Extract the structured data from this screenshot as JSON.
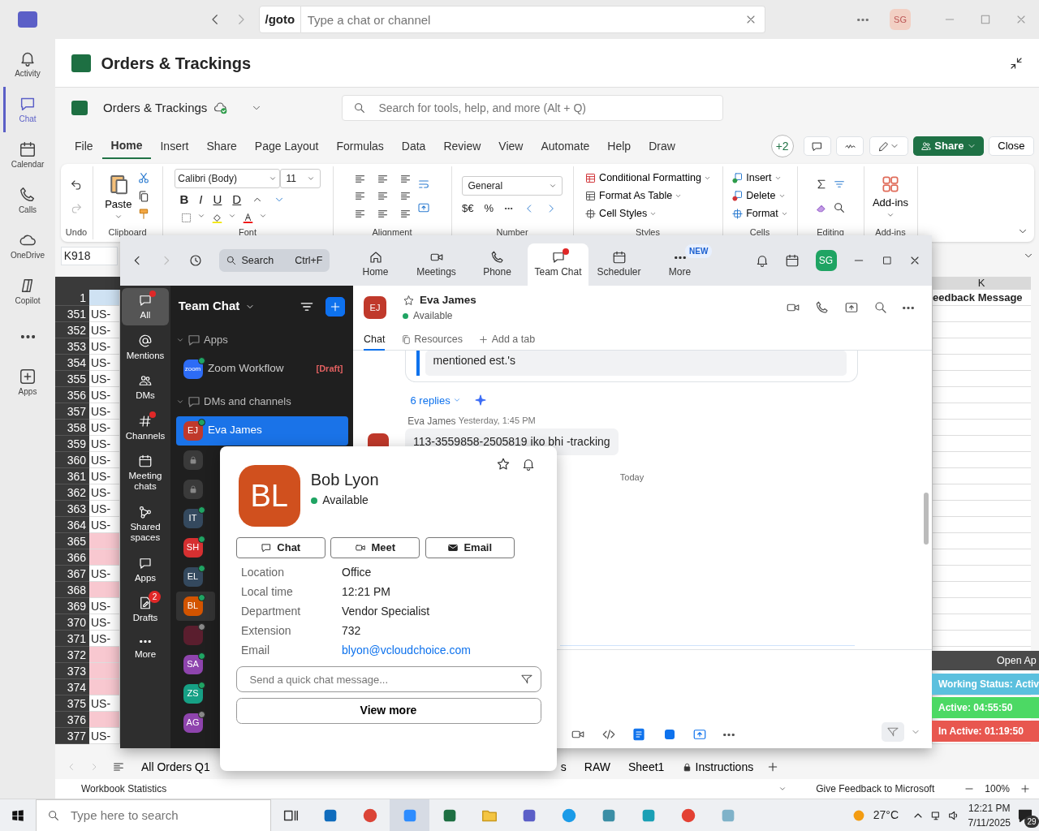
{
  "teams_bar": {
    "goto": "/goto",
    "search_placeholder": "Type a chat or channel",
    "avatar": "SG"
  },
  "teams_rail": [
    {
      "label": "Activity",
      "selected": false
    },
    {
      "label": "Chat",
      "selected": true
    },
    {
      "label": "Calendar",
      "selected": false
    },
    {
      "label": "Calls",
      "selected": false
    },
    {
      "label": "OneDrive",
      "selected": false
    },
    {
      "label": "Copilot",
      "selected": false
    },
    {
      "selected": false
    },
    {
      "label": "Apps",
      "selected": false
    }
  ],
  "excel": {
    "title": "Orders & Trackings",
    "file_name": "Orders & Trackings",
    "search_placeholder": "Search for tools, help, and more (Alt + Q)",
    "menu_tabs": [
      {
        "label": "File",
        "selected": false
      },
      {
        "label": "Home",
        "selected": true
      },
      {
        "label": "Insert",
        "selected": false
      },
      {
        "label": "Share",
        "selected": false
      },
      {
        "label": "Page Layout",
        "selected": false
      },
      {
        "label": "Formulas",
        "selected": false
      },
      {
        "label": "Data",
        "selected": false
      },
      {
        "label": "Review",
        "selected": false
      },
      {
        "label": "View",
        "selected": false
      },
      {
        "label": "Automate",
        "selected": false
      },
      {
        "label": "Help",
        "selected": false
      },
      {
        "label": "Draw",
        "selected": false
      }
    ],
    "coauthors": "+2",
    "share": "Share",
    "close": "Close",
    "ribbon": {
      "undo": "Undo",
      "paste": "Paste",
      "clipboard": "Clipboard",
      "font_name": "Calibri (Body)",
      "font_size": "11",
      "font_buttons": [
        "B",
        "I",
        "U",
        "D"
      ],
      "font": "Font",
      "alignment": "Alignment",
      "number_format": "General",
      "currency": "$€",
      "percent": "%",
      "number": "Number",
      "styles_items": [
        "Conditional Formatting",
        "Format As Table",
        "Cell Styles"
      ],
      "styles": "Styles",
      "cells_items": [
        "Insert",
        "Delete",
        "Format"
      ],
      "cells": "Cells",
      "editing": "Editing",
      "addins_button": "Add-ins",
      "addins": "Add-ins"
    },
    "name_box": "K918",
    "grid": {
      "column_k": "K",
      "k_header_cell": "eedback Message",
      "rows": [
        {
          "number": "1",
          "highlighted": false
        },
        {
          "number": "351",
          "cell": "US-",
          "highlighted": false
        },
        {
          "number": "352",
          "cell": "US-",
          "highlighted": false
        },
        {
          "number": "353",
          "cell": "US-",
          "highlighted": false
        },
        {
          "number": "354",
          "cell": "US-",
          "highlighted": false
        },
        {
          "number": "355",
          "cell": "US-",
          "highlighted": false
        },
        {
          "number": "356",
          "cell": "US-",
          "highlighted": false
        },
        {
          "number": "357",
          "cell": "US-",
          "highlighted": false
        },
        {
          "number": "358",
          "cell": "US-",
          "highlighted": false
        },
        {
          "number": "359",
          "cell": "US-",
          "highlighted": false
        },
        {
          "number": "360",
          "cell": "US-",
          "highlighted": false
        },
        {
          "number": "361",
          "cell": "US-",
          "highlighted": false
        },
        {
          "number": "362",
          "cell": "US-",
          "highlighted": false
        },
        {
          "number": "363",
          "cell": "US-",
          "highlighted": false
        },
        {
          "number": "364",
          "cell": "US-",
          "highlighted": false
        },
        {
          "number": "365",
          "highlighted": true
        },
        {
          "number": "366",
          "highlighted": true
        },
        {
          "number": "367",
          "cell": "US-",
          "highlighted": false
        },
        {
          "number": "368",
          "highlighted": true
        },
        {
          "number": "369",
          "cell": "US-",
          "highlighted": false
        },
        {
          "number": "370",
          "cell": "US-",
          "highlighted": false
        },
        {
          "number": "371",
          "cell": "US-",
          "highlighted": false
        },
        {
          "number": "372",
          "highlighted": true
        },
        {
          "number": "373",
          "highlighted": true
        },
        {
          "number": "374",
          "highlighted": true
        },
        {
          "number": "375",
          "cell": "US-",
          "highlighted": false
        },
        {
          "number": "376",
          "highlighted": true
        },
        {
          "number": "377",
          "cell": "US-",
          "highlighted": false
        }
      ]
    },
    "sheet_tabs": [
      {
        "label": "All Orders Q1",
        "locked": false
      },
      {
        "label": "s",
        "locked": false
      },
      {
        "label": "RAW",
        "locked": false
      },
      {
        "label": "Sheet1",
        "locked": false
      },
      {
        "label": "Instructions",
        "locked": true
      }
    ],
    "status_bar": {
      "left": "Workbook Statistics",
      "feedback": "Give Feedback to Microsoft",
      "zoom": "100%"
    }
  },
  "zoom_window": {
    "search": "Search",
    "shortcut": "Ctrl+F",
    "nav_tabs": [
      {
        "label": "Home",
        "selected": false,
        "unread": false
      },
      {
        "label": "Meetings",
        "selected": false,
        "unread": false
      },
      {
        "label": "Phone",
        "selected": false,
        "unread": false
      },
      {
        "label": "Team Chat",
        "selected": true,
        "unread": true
      },
      {
        "label": "Scheduler",
        "selected": false,
        "unread": false
      },
      {
        "label": "More",
        "selected": false,
        "unread": false,
        "badge": "NEW"
      }
    ],
    "avatar": "SG",
    "sidebar": [
      {
        "label": "All",
        "selected": true,
        "unread": true
      },
      {
        "label": "Mentions",
        "selected": false,
        "unread": false
      },
      {
        "label": "DMs",
        "selected": false,
        "unread": false
      },
      {
        "label": "Channels",
        "selected": false,
        "unread": true
      },
      {
        "label": "Meeting chats",
        "selected": false,
        "unread": false
      },
      {
        "label": "Shared spaces",
        "selected": false,
        "unread": false
      },
      {
        "label": "Apps",
        "selected": false,
        "unread": false
      },
      {
        "label": "Drafts",
        "selected": false,
        "unread": false,
        "badge": "2"
      },
      {
        "label": "More",
        "selected": false,
        "unread": false
      }
    ],
    "list_title": "Team Chat",
    "sections": [
      {
        "label": "Apps",
        "items": [
          {
            "kind": "app",
            "initials": "zoom",
            "name": "Zoom Workflow",
            "tag": "[Draft]",
            "color": "#2d6cf6",
            "selected": false,
            "available": true
          }
        ]
      },
      {
        "label": "DMs and channels",
        "items": [
          {
            "kind": "person",
            "initials": "EJ",
            "name": "Eva James",
            "color": "#c0392b",
            "selected": true,
            "available": true
          },
          {
            "kind": "locked",
            "color": "#3a3a3a",
            "selected": false
          },
          {
            "kind": "locked",
            "color": "#3a3a3a",
            "selected": false
          },
          {
            "kind": "person",
            "initials": "IT",
            "color": "#34495e",
            "selected": false,
            "available": true
          },
          {
            "kind": "person",
            "initials": "SH",
            "color": "#d63031",
            "selected": false,
            "available": true
          },
          {
            "kind": "person",
            "initials": "EL",
            "color": "#34495e",
            "selected": false,
            "available": true
          },
          {
            "kind": "person",
            "initials": "BL",
            "color": "#d35400",
            "selected": false,
            "available": true
          },
          {
            "kind": "person",
            "color": "#5a1e2e",
            "selected": false,
            "available": false
          },
          {
            "kind": "person",
            "initials": "SA",
            "color": "#8e44ad",
            "selected": false,
            "available": true
          },
          {
            "kind": "person",
            "initials": "ZS",
            "color": "#16a085",
            "selected": false,
            "available": true
          },
          {
            "kind": "person",
            "initials": "AG",
            "color": "#8e44ad",
            "selected": false,
            "available": false
          }
        ]
      }
    ],
    "chat": {
      "initials": "EJ",
      "name": "Eva James",
      "status": "Available",
      "tabs": [
        {
          "label": "Chat",
          "selected": true
        },
        {
          "label": "Resources",
          "selected": false
        },
        {
          "label": "Add a tab",
          "selected": false
        }
      ],
      "quote": "mentioned est.'s",
      "replies": "6 replies",
      "sender": "Eva James",
      "time": "Yesterday, 1:45 PM",
      "message": "113-3559858-2505819 iko bhi -tracking",
      "divider": "Today"
    }
  },
  "contact_card": {
    "initials": "BL",
    "name": "Bob Lyon",
    "status": "Available",
    "actions": [
      "Chat",
      "Meet",
      "Email"
    ],
    "details": [
      {
        "label": "Location",
        "value": "Office",
        "kind": "text"
      },
      {
        "label": "Local time",
        "value": "12:21 PM",
        "kind": "text"
      },
      {
        "label": "Department",
        "value": "Vendor Specialist",
        "kind": "text"
      },
      {
        "label": "Extension",
        "value": "732",
        "kind": "text"
      },
      {
        "label": "Email",
        "value": "blyon@vcloudchoice.com",
        "kind": "link"
      }
    ],
    "message_placeholder": "Send a quick chat message...",
    "view_more": "View more"
  },
  "status_widget": {
    "title": "Open Ap",
    "items": [
      {
        "text": "Working Status: Activ",
        "color": "#5bc0de"
      },
      {
        "text": "Active: 04:55:50",
        "color": "#4cd964"
      },
      {
        "text": "In Active: 01:19:50",
        "color": "#e8574f"
      }
    ]
  },
  "taskbar": {
    "search_placeholder": "Type here to search",
    "temperature": "27°C",
    "time": "12:21 PM",
    "date": "7/11/2025",
    "notifications": "29"
  }
}
